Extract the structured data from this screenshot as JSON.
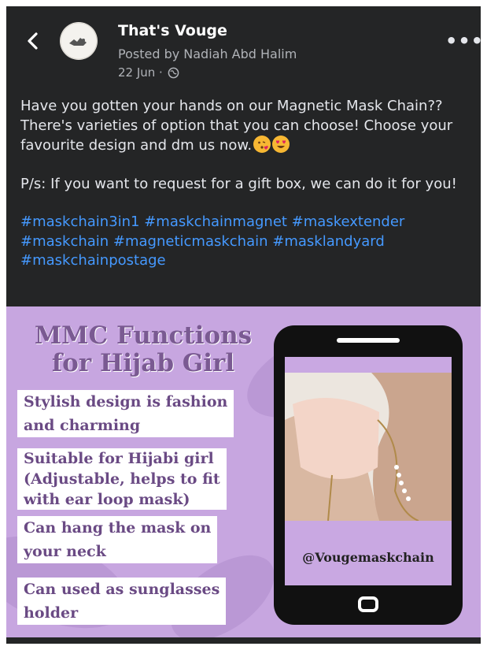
{
  "header": {
    "back_icon": "chevron-left-icon",
    "page_name": "That's Vouge",
    "posted_by": "Posted by Nadiah Abd Halim",
    "date": "22 Jun ·",
    "privacy_icon": "globe-icon",
    "more_icon": "more-horizontal-icon",
    "avatar_text": "That's Vouge"
  },
  "post": {
    "paragraph1": "Have you gotten your hands on our Magnetic Mask Chain?? There's varieties of option that you can choose! Choose your favourite design and dm us now.",
    "emojis": [
      "face-blowing-kiss-emoji",
      "smiling-face-with-heart-eyes-emoji"
    ],
    "paragraph2": "P/s: If you want to request for a gift box, we can do it for you!",
    "hashtags": "#maskchain3in1 #maskchainmagnet #maskextender #maskchain #magneticmaskchain #masklandyard #maskchainpostage",
    "link_color": "#4599ff"
  },
  "promo": {
    "title_line1": "MMC Functions",
    "title_line2": "for Hijab Girl",
    "features": [
      {
        "lines": [
          "Stylish design is fashion",
          "and charming"
        ]
      },
      {
        "lines": [
          "Suitable for Hijabi girl",
          "(Adjustable, helps to fit",
          "with ear loop mask)"
        ]
      },
      {
        "lines": [
          "Can hang the mask on",
          "your neck"
        ]
      },
      {
        "lines": [
          "Can used as sunglasses",
          "holder"
        ]
      }
    ],
    "handle": "@Vougemaskchain",
    "accent": "#c7a6e0"
  }
}
